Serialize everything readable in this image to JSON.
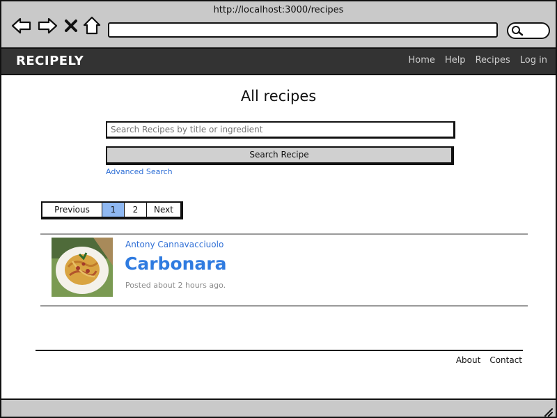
{
  "browser": {
    "url": "http://localhost:3000/recipes",
    "icons": [
      "back-arrow-icon",
      "forward-arrow-icon",
      "close-x-icon",
      "home-icon",
      "search-icon"
    ]
  },
  "navbar": {
    "brand": "RECIPELY",
    "links": {
      "home": "Home",
      "help": "Help",
      "recipes": "Recipes",
      "login": "Log in"
    }
  },
  "main": {
    "title": "All recipes",
    "search": {
      "placeholder": "Search Recipes by title or ingredient",
      "value": "",
      "button_label": "Search Recipe",
      "advanced_link": "Advanced Search"
    },
    "pagination": {
      "previous": "Previous",
      "pages": [
        "1",
        "2"
      ],
      "current": "1",
      "next": "Next"
    },
    "recipes": [
      {
        "author": "Antony Cannavacciuolo",
        "title": "Carbonara",
        "posted": "Posted about 2 hours ago."
      }
    ]
  },
  "footer": {
    "about": "About",
    "contact": "Contact"
  },
  "colors": {
    "chrome": "#c9c9c9",
    "navbar": "#333333",
    "link": "#2f6fd6",
    "active_page": "#8fb8f2"
  }
}
